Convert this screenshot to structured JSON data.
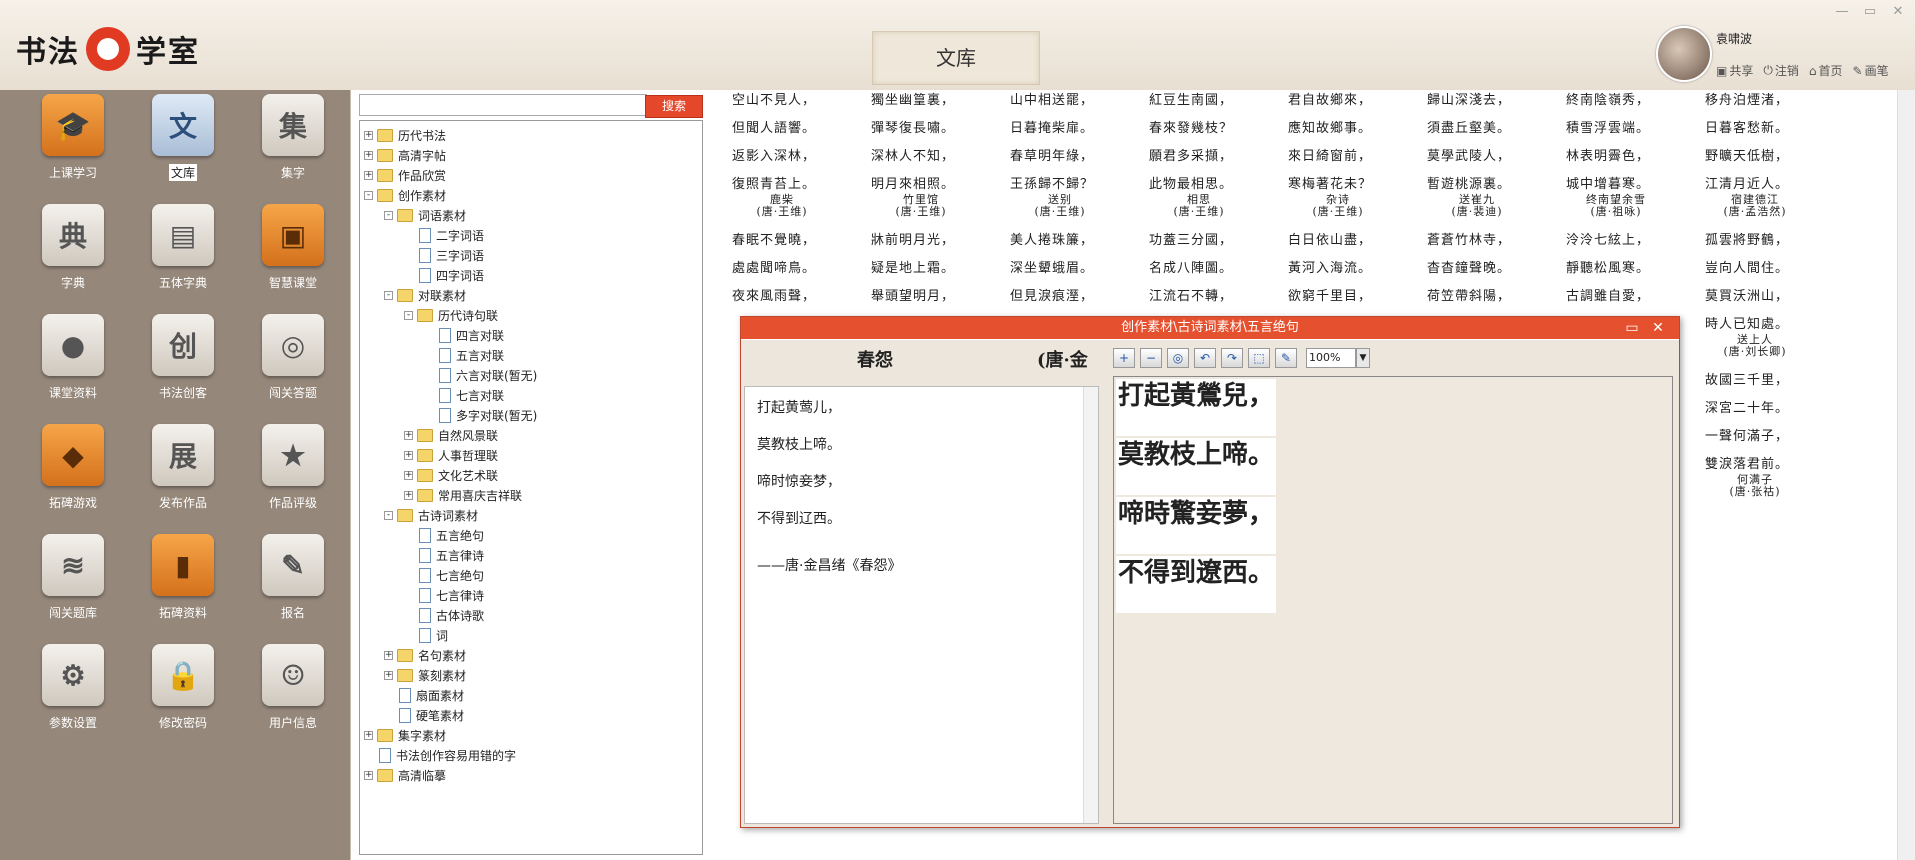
{
  "app": {
    "logo_left": "书法",
    "logo_right": "学室",
    "page_title": "文库"
  },
  "user": {
    "name": "袁啸波",
    "actions": [
      "共享",
      "注销",
      "首页",
      "画笔"
    ]
  },
  "sidebar": {
    "tiles": [
      {
        "label": "上课学习",
        "glyph": "🎓",
        "style": "orange",
        "icon": "graduation-cap-icon"
      },
      {
        "label": "文库",
        "glyph": "文",
        "style": "blue",
        "icon": "library-icon",
        "selected": true
      },
      {
        "label": "集字",
        "glyph": "集",
        "style": "gray",
        "icon": "collect-chars-icon"
      },
      {
        "label": "字典",
        "glyph": "典",
        "style": "gray",
        "icon": "dictionary-icon"
      },
      {
        "label": "五体字典",
        "glyph": "▤",
        "style": "gray",
        "icon": "five-style-dictionary-icon"
      },
      {
        "label": "智慧课堂",
        "glyph": "▣",
        "style": "orange",
        "icon": "smart-classroom-icon"
      },
      {
        "label": "课堂资料",
        "glyph": "●",
        "style": "gray",
        "icon": "class-materials-icon"
      },
      {
        "label": "书法创客",
        "glyph": "创",
        "style": "gray",
        "icon": "maker-icon"
      },
      {
        "label": "闯关答题",
        "glyph": "◎",
        "style": "gray",
        "icon": "quiz-icon"
      },
      {
        "label": "拓碑游戏",
        "glyph": "◆",
        "style": "orange",
        "icon": "game-controller-icon"
      },
      {
        "label": "发布作品",
        "glyph": "展",
        "style": "gray",
        "icon": "publish-icon"
      },
      {
        "label": "作品评级",
        "glyph": "★",
        "style": "gray",
        "icon": "rating-icon"
      },
      {
        "label": "闯关题库",
        "glyph": "≋",
        "style": "gray",
        "icon": "layers-icon"
      },
      {
        "label": "拓碑资料",
        "glyph": "▮",
        "style": "orange",
        "icon": "book-icon"
      },
      {
        "label": "报名",
        "glyph": "✎",
        "style": "gray",
        "icon": "signup-icon"
      },
      {
        "label": "参数设置",
        "glyph": "⚙",
        "style": "gray",
        "icon": "gear-icon"
      },
      {
        "label": "修改密码",
        "glyph": "🔒",
        "style": "gray",
        "icon": "lock-icon"
      },
      {
        "label": "用户信息",
        "glyph": "☺",
        "style": "gray",
        "icon": "user-icon"
      }
    ]
  },
  "search": {
    "value": "",
    "button": "搜索"
  },
  "tree": [
    {
      "label": "历代书法",
      "level": 0,
      "type": "folder",
      "toggle": "+"
    },
    {
      "label": "高清字帖",
      "level": 0,
      "type": "folder",
      "toggle": "+"
    },
    {
      "label": "作品欣赏",
      "level": 0,
      "type": "folder",
      "toggle": "+"
    },
    {
      "label": "创作素材",
      "level": 0,
      "type": "folder",
      "toggle": "-"
    },
    {
      "label": "词语素材",
      "level": 1,
      "type": "folder",
      "toggle": "-"
    },
    {
      "label": "二字词语",
      "level": 2,
      "type": "doc",
      "toggle": ""
    },
    {
      "label": "三字词语",
      "level": 2,
      "type": "doc",
      "toggle": ""
    },
    {
      "label": "四字词语",
      "level": 2,
      "type": "doc",
      "toggle": ""
    },
    {
      "label": "对联素材",
      "level": 1,
      "type": "folder",
      "toggle": "-"
    },
    {
      "label": "历代诗句联",
      "level": 2,
      "type": "folder",
      "toggle": "-"
    },
    {
      "label": "四言对联",
      "level": 3,
      "type": "doc",
      "toggle": ""
    },
    {
      "label": "五言对联",
      "level": 3,
      "type": "doc",
      "toggle": ""
    },
    {
      "label": "六言对联(暂无)",
      "level": 3,
      "type": "doc",
      "toggle": ""
    },
    {
      "label": "七言对联",
      "level": 3,
      "type": "doc",
      "toggle": ""
    },
    {
      "label": "多字对联(暂无)",
      "level": 3,
      "type": "doc",
      "toggle": ""
    },
    {
      "label": "自然风景联",
      "level": 2,
      "type": "folder",
      "toggle": "+"
    },
    {
      "label": "人事哲理联",
      "level": 2,
      "type": "folder",
      "toggle": "+"
    },
    {
      "label": "文化艺术联",
      "level": 2,
      "type": "folder",
      "toggle": "+"
    },
    {
      "label": "常用喜庆吉祥联",
      "level": 2,
      "type": "folder",
      "toggle": "+"
    },
    {
      "label": "古诗词素材",
      "level": 1,
      "type": "folder",
      "toggle": "-"
    },
    {
      "label": "五言绝句",
      "level": 2,
      "type": "doc",
      "toggle": ""
    },
    {
      "label": "五言律诗",
      "level": 2,
      "type": "doc",
      "toggle": ""
    },
    {
      "label": "七言绝句",
      "level": 2,
      "type": "doc",
      "toggle": ""
    },
    {
      "label": "七言律诗",
      "level": 2,
      "type": "doc",
      "toggle": ""
    },
    {
      "label": "古体诗歌",
      "level": 2,
      "type": "doc",
      "toggle": ""
    },
    {
      "label": "词",
      "level": 2,
      "type": "doc",
      "toggle": ""
    },
    {
      "label": "名句素材",
      "level": 1,
      "type": "folder",
      "toggle": "+"
    },
    {
      "label": "篆刻素材",
      "level": 1,
      "type": "folder",
      "toggle": "+"
    },
    {
      "label": "扇面素材",
      "level": 1,
      "type": "doc",
      "toggle": ""
    },
    {
      "label": "硬笔素材",
      "level": 1,
      "type": "doc",
      "toggle": ""
    },
    {
      "label": "集字素材",
      "level": 0,
      "type": "folder",
      "toggle": "+"
    },
    {
      "label": "书法创作容易用错的字",
      "level": 0,
      "type": "doc",
      "toggle": ""
    },
    {
      "label": "高清临摹",
      "level": 0,
      "type": "folder",
      "toggle": "+"
    }
  ],
  "poems_top": [
    {
      "lines": [
        "空山不見人，",
        "但聞人語響。",
        "返影入深林，",
        "復照青苔上。"
      ],
      "title": "鹿柴",
      "author": "(唐·王维)"
    },
    {
      "lines": [
        "獨坐幽篁裏，",
        "彈琴復長嘯。",
        "深林人不知，",
        "明月來相照。"
      ],
      "title": "竹里馆",
      "author": "(唐·王维)"
    },
    {
      "lines": [
        "山中相送罷，",
        "日暮掩柴扉。",
        "春草明年綠，",
        "王孫歸不歸？"
      ],
      "title": "送别",
      "author": "(唐·王维)"
    },
    {
      "lines": [
        "紅豆生南國，",
        "春來發幾枝？",
        "願君多采擷，",
        "此物最相思。"
      ],
      "title": "相思",
      "author": "(唐·王维)"
    },
    {
      "lines": [
        "君自故鄉來，",
        "應知故鄉事。",
        "來日綺窗前，",
        "寒梅著花未？"
      ],
      "title": "杂诗",
      "author": "(唐·王维)"
    },
    {
      "lines": [
        "歸山深淺去，",
        "須盡丘壑美。",
        "莫學武陵人，",
        "暫遊桃源裏。"
      ],
      "title": "送崔九",
      "author": "(唐·裴迪)"
    },
    {
      "lines": [
        "終南陰嶺秀，",
        "積雪浮雲端。",
        "林表明霽色，",
        "城中增暮寒。"
      ],
      "title": "终南望余雪",
      "author": "(唐·祖咏)"
    },
    {
      "lines": [
        "移舟泊煙渚，",
        "日暮客愁新。",
        "野曠天低樹，",
        "江清月近人。"
      ],
      "title": "宿建德江",
      "author": "(唐·孟浩然)"
    }
  ],
  "poems_bottom": [
    {
      "lines": [
        "春眠不覺曉，",
        "處處聞啼鳥。",
        "夜來風雨聲，"
      ]
    },
    {
      "lines": [
        "牀前明月光，",
        "疑是地上霜。",
        "舉頭望明月，"
      ]
    },
    {
      "lines": [
        "美人捲珠簾，",
        "深坐顰蛾眉。",
        "但見淚痕溼，"
      ]
    },
    {
      "lines": [
        "功蓋三分國，",
        "名成八陣圖。",
        "江流石不轉，"
      ]
    },
    {
      "lines": [
        "白日依山盡，",
        "黃河入海流。",
        "欲窮千里目，"
      ]
    },
    {
      "lines": [
        "蒼蒼竹林寺，",
        "杳杳鐘聲晚。",
        "荷笠帶斜陽，"
      ]
    },
    {
      "lines": [
        "泠泠七絃上，",
        "靜聽松風寒。",
        "古調雖自愛，"
      ]
    },
    {
      "lines": [
        "孤雲將野鶴，",
        "豈向人間住。",
        "莫買沃洲山，",
        "時人已知處。"
      ],
      "title": "送上人",
      "author": "(唐·刘长卿)"
    }
  ],
  "poem_far_right": {
    "lines": [
      "故國三千里，",
      "深宮二十年。",
      "一聲何滿子，",
      "雙淚落君前。"
    ],
    "title": "何满子",
    "author": "(唐·张祜)"
  },
  "dialog": {
    "title": "创作素材\\古诗词素材\\五言绝句",
    "poem_title": "春怨",
    "poem_author": "(唐·金",
    "lines_simplified": [
      "打起黄莺儿，",
      "莫教枝上啼。",
      "啼时惊妾梦，",
      "不得到辽西。"
    ],
    "source": "——唐·金昌绪《春怨》",
    "lines_traditional": [
      "打起黃鶯兒，",
      "莫教枝上啼。",
      "啼時驚妾夢，",
      "不得到遼西。"
    ],
    "zoom": "100%",
    "tools": [
      {
        "glyph": "+",
        "icon": "zoom-in-icon"
      },
      {
        "glyph": "−",
        "icon": "zoom-out-icon"
      },
      {
        "glyph": "◎",
        "icon": "zoom-fit-icon"
      },
      {
        "glyph": "↶",
        "icon": "rotate-left-icon"
      },
      {
        "glyph": "↷",
        "icon": "rotate-right-icon"
      },
      {
        "glyph": "⬚",
        "icon": "select-area-icon"
      },
      {
        "glyph": "✎",
        "icon": "pencil-icon"
      }
    ]
  }
}
